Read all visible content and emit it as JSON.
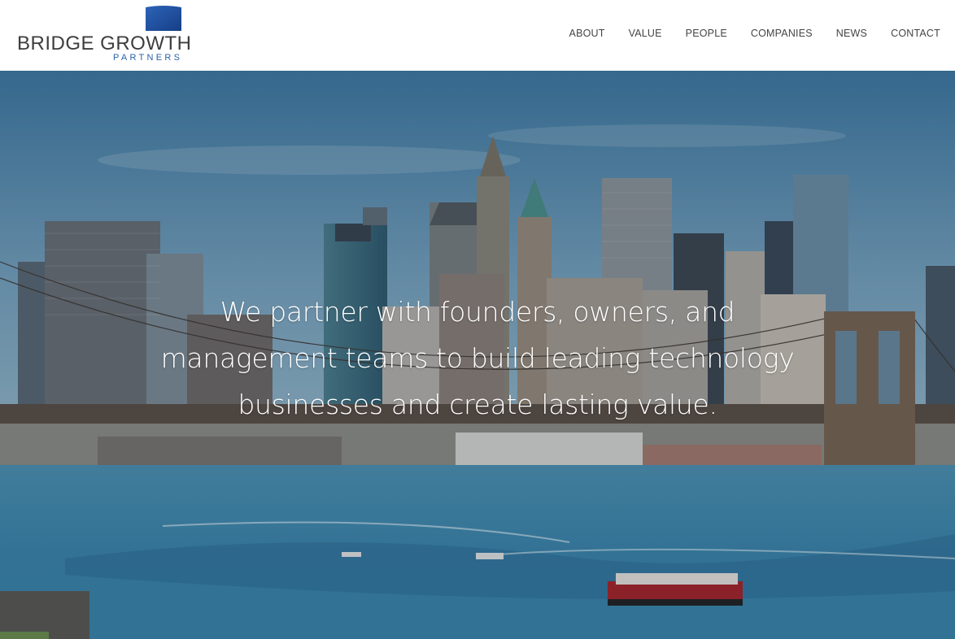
{
  "brand": {
    "name": "BRIDGE GROWTH",
    "sub": "PARTNERS",
    "mark_color": "#1f4fa0"
  },
  "nav": {
    "items": [
      {
        "label": "ABOUT"
      },
      {
        "label": "VALUE"
      },
      {
        "label": "PEOPLE"
      },
      {
        "label": "COMPANIES"
      },
      {
        "label": "NEWS"
      },
      {
        "label": "CONTACT"
      }
    ]
  },
  "hero": {
    "tagline": "We partner with founders, owners, and management teams to build leading technology businesses and create lasting value.",
    "image": "city-skyline-bridge-river"
  }
}
